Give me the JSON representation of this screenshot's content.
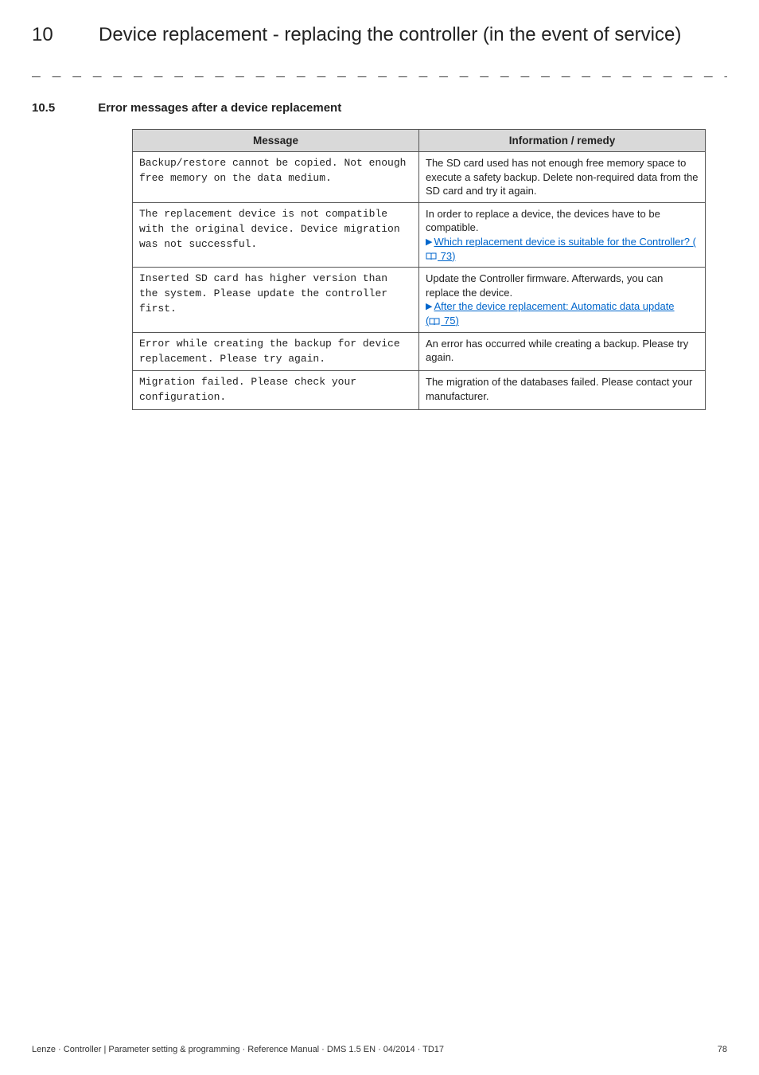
{
  "chapter": {
    "number": "10",
    "title": "Device replacement - replacing the controller (in the event of service)"
  },
  "dashes": "_ _ _ _ _ _ _ _ _ _ _ _ _ _ _ _ _ _ _ _ _ _ _ _ _ _ _ _ _ _ _ _ _ _ _ _ _ _ _ _ _ _ _ _ _ _ _ _ _ _ _ _ _ _ _ _ _ _ _ _ _ _ _ _",
  "section": {
    "number": "10.5",
    "title": "Error messages after a device replacement"
  },
  "table": {
    "headers": [
      "Message",
      "Information / remedy"
    ],
    "rows": [
      {
        "message": "Backup/restore cannot be copied. Not enough free memory on the data medium.",
        "info_plain": "The SD card used has not enough free memory space to execute a safety backup. Delete non-required data from the SD card and try it again."
      },
      {
        "message": "The replacement device is not compatible with the original device. Device migration was not successful.",
        "info_plain": "In order to replace a device, the devices have to be compatible.",
        "link_text": "Which replacement device is suitable for the Controller?",
        "pageref": "73"
      },
      {
        "message": "Inserted SD card has higher version than the system. Please update the controller first.",
        "info_plain": "Update the Controller firmware. Afterwards, you can replace the device.",
        "link_text": "After the device replacement: Automatic data update",
        "pageref": "75"
      },
      {
        "message": "Error while creating the backup for device replacement. Please try again.",
        "info_plain": "An error has occurred while creating a backup. Please try again."
      },
      {
        "message": "Migration failed. Please check your configuration.",
        "info_plain": "The migration of the databases failed. Please contact your manufacturer."
      }
    ]
  },
  "footer": {
    "left": "Lenze · Controller |  Parameter setting & programming · Reference Manual · DMS 1.5 EN · 04/2014 · TD17",
    "right": "78"
  }
}
